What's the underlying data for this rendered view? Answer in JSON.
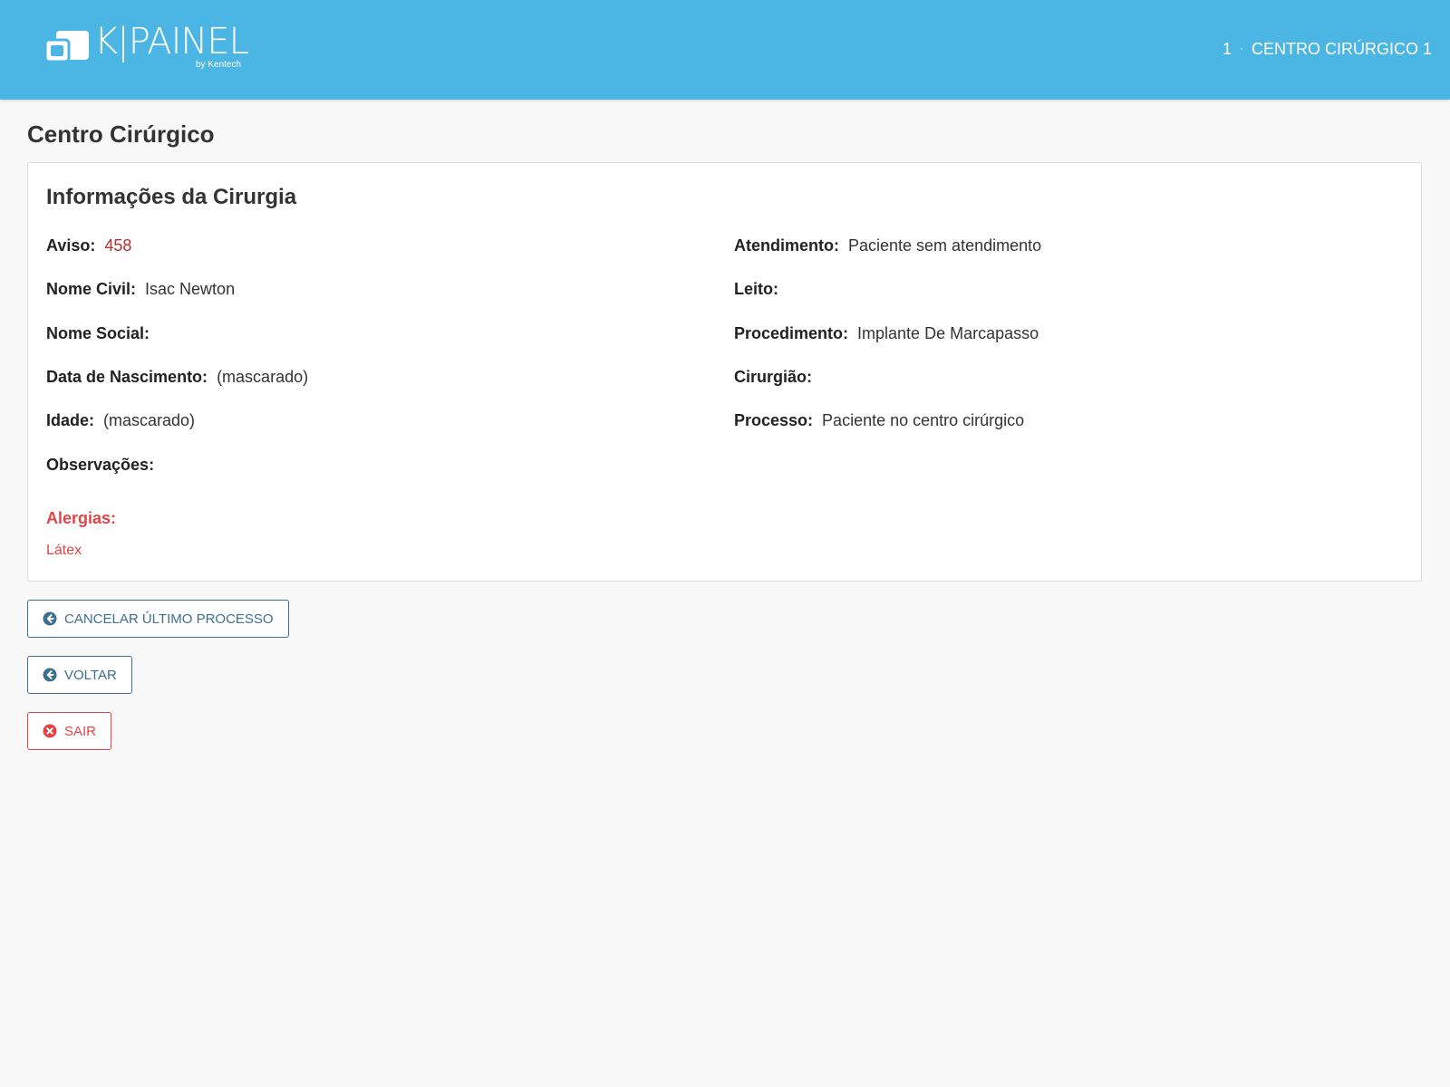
{
  "header": {
    "logo_text": "K|PAINEL",
    "logo_sub": "by Kentech",
    "breadcrumb": {
      "number": "1",
      "separator": "·",
      "location": "CENTRO CIRÚRGICO 1"
    }
  },
  "page_title": "Centro Cirúrgico",
  "card": {
    "title": "Informações da Cirurgia",
    "left_fields": [
      {
        "label": "Aviso:",
        "value": "458"
      },
      {
        "label": "Nome Civil:",
        "value": "Isac Newton"
      },
      {
        "label": "Nome Social:",
        "value": ""
      },
      {
        "label": "Data de Nascimento:",
        "value": "(mascarado)"
      },
      {
        "label": "Idade:",
        "value": "(mascarado)"
      },
      {
        "label": "Observações:",
        "value": ""
      }
    ],
    "right_fields": [
      {
        "label": "Atendimento:",
        "value": "Paciente sem atendimento"
      },
      {
        "label": "Leito:",
        "value": ""
      },
      {
        "label": "Procedimento:",
        "value": "Implante De Marcapasso"
      },
      {
        "label": "Cirurgião:",
        "value": ""
      },
      {
        "label": "Processo:",
        "value": "Paciente no centro cirúrgico"
      }
    ],
    "allergies_label": "Alergias:",
    "allergies": [
      "Látex"
    ]
  },
  "buttons": {
    "cancel_last": {
      "label": "CANCELAR ÚLTIMO PROCESSO",
      "icon": "arrow-circle-left-icon"
    },
    "back": {
      "label": "VOLTAR",
      "icon": "arrow-circle-left-icon"
    },
    "exit": {
      "label": "SAIR",
      "icon": "times-circle-icon"
    }
  },
  "colors": {
    "header_bg": "#4bb5e3",
    "accent": "#3d6f8e",
    "danger": "#e24545",
    "aviso_value": "#b82d2d"
  }
}
